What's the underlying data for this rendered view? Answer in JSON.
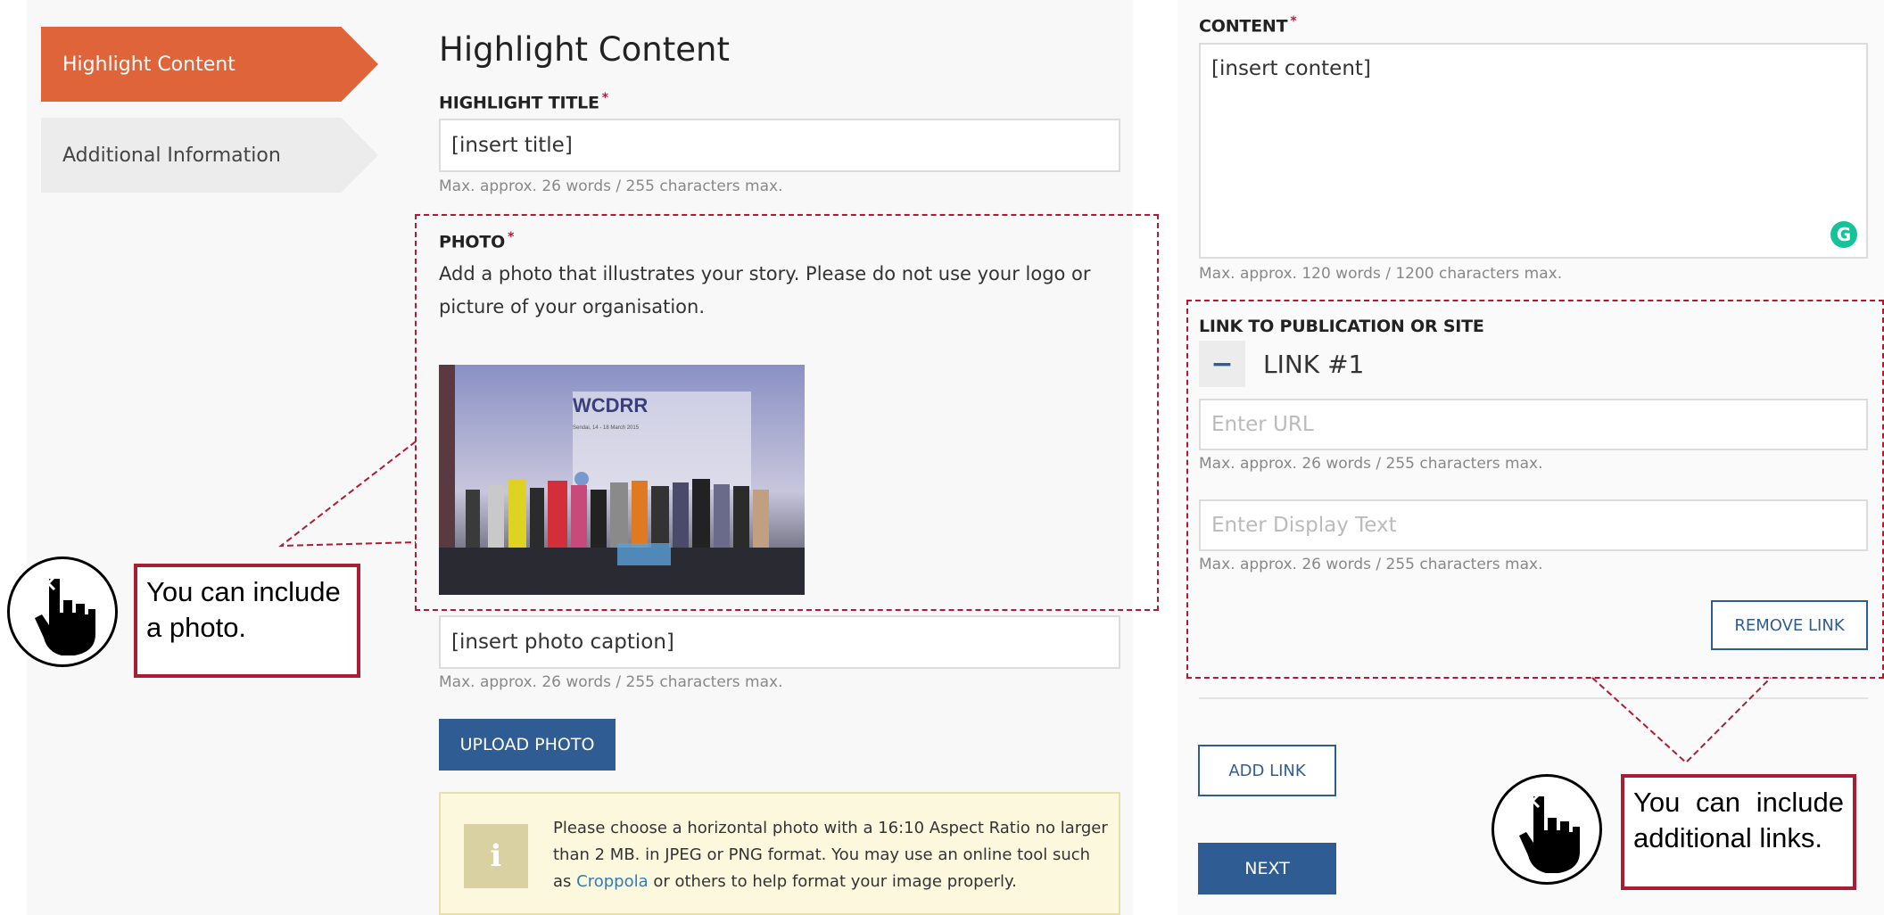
{
  "sidebar": {
    "tabs": [
      {
        "label": "Highlight Content",
        "active": true
      },
      {
        "label": "Additional Information",
        "active": false
      }
    ]
  },
  "main": {
    "title": "Highlight Content",
    "highlight_title": {
      "label": "HIGHLIGHT TITLE",
      "required_mark": "*",
      "value": "[insert title]",
      "hint": "Max. approx. 26 words / 255 characters max."
    },
    "photo": {
      "label": "PHOTO",
      "required_mark": "*",
      "description_line1": "Add a photo that illustrates your story. Please do not use your logo or",
      "description_line2": "picture of your organisation.",
      "image_text": "WCDRR",
      "image_subtext": "Sendai, 14 - 18 March 2015",
      "caption_value": "[insert photo caption]",
      "caption_hint": "Max. approx. 26 words / 255 characters max.",
      "upload_button": "UPLOAD PHOTO"
    },
    "info": {
      "line1": "Please choose a horizontal photo with a 16:10 Aspect Ratio no larger",
      "line2": "than 2 MB. in JPEG or PNG format.  You may use an online tool such",
      "line3_pre": "as ",
      "line3_link": "Croppola",
      "line3_post": " or others to help format your image properly.",
      "icon": "info-icon"
    }
  },
  "right": {
    "content": {
      "label": "CONTENT",
      "required_mark": "*",
      "value": "[insert content]",
      "hint": "Max. approx. 120 words / 1200 characters max.",
      "grammarly_icon": "G"
    },
    "links": {
      "label": "LINK TO PUBLICATION OR SITE",
      "collapse_symbol": "−",
      "link_title": "LINK #1",
      "url_placeholder": "Enter URL",
      "url_hint": "Max. approx. 26 words / 255 characters max.",
      "display_placeholder": "Enter Display Text",
      "display_hint": "Max. approx. 26 words / 255 characters max.",
      "remove_button": "REMOVE LINK",
      "add_button": "ADD LINK",
      "next_button": "NEXT"
    }
  },
  "callouts": {
    "photo": "You can include a photo.",
    "links": "You can include additional links."
  },
  "colors": {
    "accent_orange": "#e0643a",
    "primary_blue": "#2f5d93",
    "callout_red": "#a81f35"
  }
}
